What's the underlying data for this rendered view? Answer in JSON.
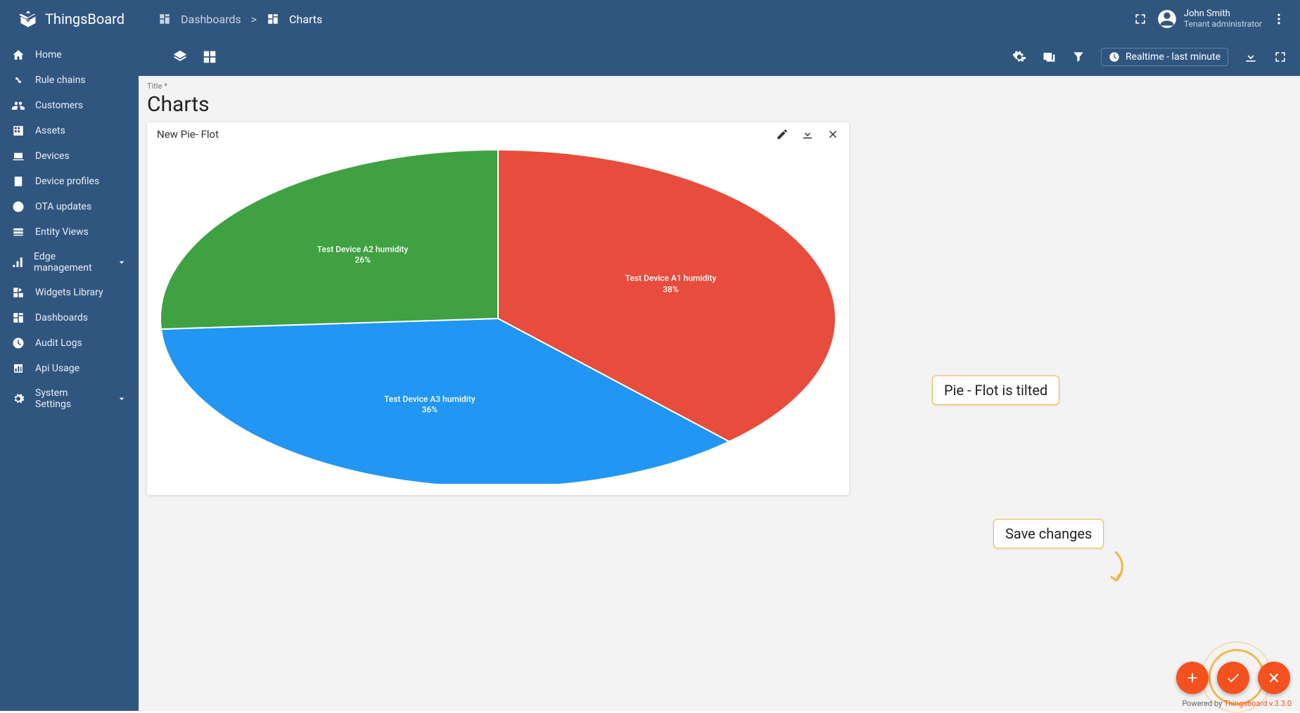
{
  "brand": "ThingsBoard",
  "breadcrumb": {
    "root": "Dashboards",
    "current": "Charts",
    "sep": ">"
  },
  "user": {
    "name": "John Smith",
    "role": "Tenant administrator"
  },
  "sidebar": {
    "items": [
      {
        "label": "Home"
      },
      {
        "label": "Rule chains"
      },
      {
        "label": "Customers"
      },
      {
        "label": "Assets"
      },
      {
        "label": "Devices"
      },
      {
        "label": "Device profiles"
      },
      {
        "label": "OTA updates"
      },
      {
        "label": "Entity Views"
      },
      {
        "label": "Edge management",
        "expandable": true
      },
      {
        "label": "Widgets Library"
      },
      {
        "label": "Dashboards"
      },
      {
        "label": "Audit Logs"
      },
      {
        "label": "Api Usage"
      },
      {
        "label": "System Settings",
        "expandable": true
      }
    ]
  },
  "toolbar": {
    "time": "Realtime - last minute"
  },
  "page": {
    "title_label": "Title *",
    "title": "Charts"
  },
  "widget": {
    "title": "New Pie- Flot"
  },
  "annotations": {
    "tilt": "Pie - Flot is tilted",
    "save": "Save changes"
  },
  "footer": {
    "prefix": "Powered by ",
    "product": "Thingsboard v.3.3.0"
  },
  "chart_data": {
    "type": "pie",
    "title": "New Pie- Flot",
    "series": [
      {
        "name": "Test Device A1 humidity",
        "value": 38,
        "label": "38%",
        "color": "#e74c3c"
      },
      {
        "name": "Test Device A3 humidity",
        "value": 36,
        "label": "36%",
        "color": "#2196f3"
      },
      {
        "name": "Test Device A2 humidity",
        "value": 26,
        "label": "26%",
        "color": "#3fa142"
      }
    ],
    "style": "tilted-ellipse"
  }
}
